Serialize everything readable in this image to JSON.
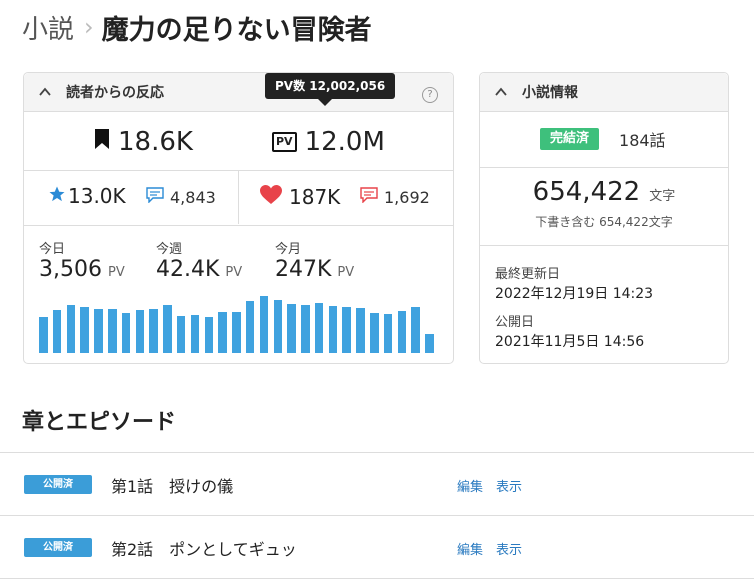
{
  "breadcrumb": {
    "parent": "小説",
    "separator": "›",
    "title": "魔力の足りない冒険者"
  },
  "reactions": {
    "header": "読者からの反応",
    "tooltip": "PV数 12,002,056",
    "help": "?",
    "bookmarks": "18.6K",
    "pv_icon": "PV",
    "pv_total": "12.0M",
    "stars": "13.0K",
    "star_comments": "4,843",
    "hearts": "187K",
    "heart_comments": "1,692",
    "periods": [
      {
        "label": "今日",
        "value": "3,506",
        "unit": "PV"
      },
      {
        "label": "今週",
        "value": "42.4K",
        "unit": "PV"
      },
      {
        "label": "今月",
        "value": "247K",
        "unit": "PV"
      }
    ]
  },
  "chart_data": {
    "type": "bar",
    "title": "",
    "xlabel": "",
    "ylabel": "",
    "values": [
      36,
      43,
      48,
      46,
      44,
      44,
      40,
      43,
      44,
      48,
      37,
      38,
      36,
      41,
      41,
      52,
      57,
      53,
      49,
      48,
      50,
      47,
      46,
      45,
      40,
      39,
      42,
      46,
      19
    ],
    "ylim": [
      0,
      60
    ]
  },
  "novel_info": {
    "header": "小説情報",
    "status": "完結済",
    "episodes": "184話",
    "chars": "654,422",
    "chars_unit": "文字",
    "drafts": "下書き含む 654,422文字",
    "updated_label": "最終更新日",
    "updated": "2022年12月19日 14:23",
    "published_label": "公開日",
    "published": "2021年11月5日 14:56"
  },
  "episodes_section": {
    "title": "章とエピソード",
    "items": [
      {
        "badge": "公開済",
        "title": "第1話　授けの儀",
        "edit": "編集",
        "view": "表示"
      },
      {
        "badge": "公開済",
        "title": "第2話　ポンとしてギュッ",
        "edit": "編集",
        "view": "表示"
      }
    ]
  },
  "colors": {
    "accent_blue": "#3fa2df",
    "complete_green": "#3ec07c",
    "heart_red": "#e8434a",
    "star_blue": "#2b8bd6"
  }
}
